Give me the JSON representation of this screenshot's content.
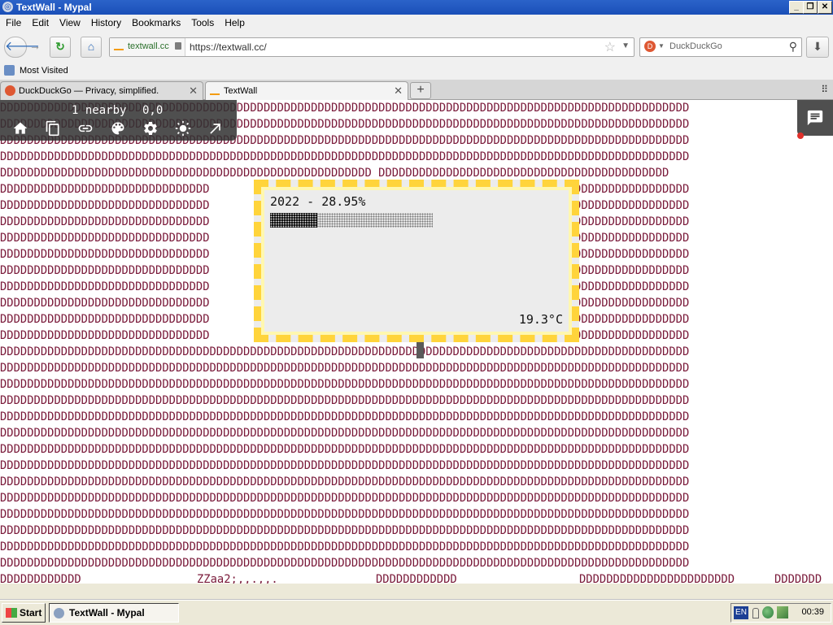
{
  "window": {
    "title": "TextWall - Mypal"
  },
  "menu": [
    "File",
    "Edit",
    "View",
    "History",
    "Bookmarks",
    "Tools",
    "Help"
  ],
  "nav": {
    "site_label": "textwall.cc",
    "url": "https://textwall.cc/",
    "search_placeholder": "DuckDuckGo"
  },
  "bookmarks": {
    "most_visited": "Most Visited"
  },
  "tabs": [
    {
      "label": "DuckDuckGo — Privacy, simplified.",
      "icon": "duckduckgo-icon"
    },
    {
      "label": "TextWall",
      "icon": "textwall-icon"
    }
  ],
  "toolbar": {
    "nearby": "1 nearby",
    "coords": "0,0",
    "icons": [
      "home-icon",
      "copy-icon",
      "link-icon",
      "palette-icon",
      "gear-icon",
      "brightness-icon",
      "arrow-up-right-icon"
    ]
  },
  "wall": {
    "char": "D",
    "row_width": 102,
    "widget_gap_rows": [
      5,
      14
    ],
    "gap_row4": "DDDDDDDDDDDDDDDDDDDDDDDDDDDDDDDDDDDDDDDDDDDDDDDDDDDDDDD DDDDDDDDDDDDDDDDDDDDDDDDDDDDDDDDDDDDDDDDDDD",
    "bottom_segments": [
      "DDDDDDDDDDDD",
      "ZZaa2;,,.,,.",
      "DDDDDDDDDDDD",
      "DDDDDDDDDDDDDDDDDDDDDDD",
      "DDDDDDD"
    ],
    "colors": {
      "text": "#7a1a3a",
      "cursor": "#5a5a5a"
    }
  },
  "widget": {
    "title": "2022 - 28.95%",
    "progress": 0.2895,
    "temperature": "19.3°C",
    "colors": {
      "border": "#ffd43b",
      "background": "#ececec"
    }
  },
  "taskbar": {
    "start": "Start",
    "task": "TextWall - Mypal",
    "lang": "EN",
    "clock": "00:39"
  }
}
